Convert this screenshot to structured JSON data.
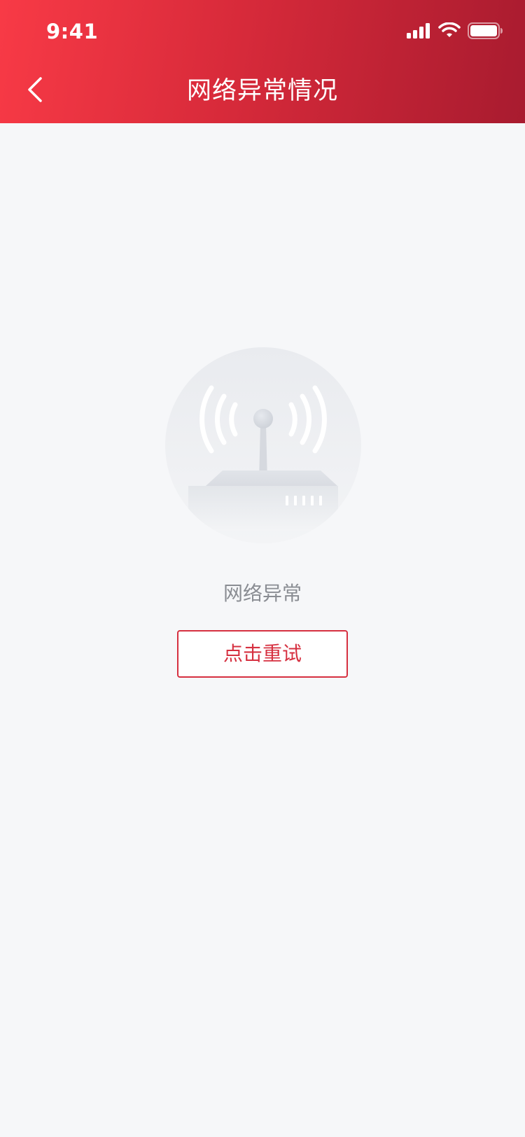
{
  "status_bar": {
    "time": "9:41",
    "icons": [
      "cellular-signal-icon",
      "wifi-icon",
      "battery-icon"
    ]
  },
  "nav": {
    "back_icon": "chevron-left-icon",
    "title": "网络异常情况"
  },
  "illustration": {
    "icon": "router-signal-icon"
  },
  "error": {
    "message": "网络异常",
    "retry_label": "点击重试"
  },
  "colors": {
    "header_gradient_start": "#f83a46",
    "header_gradient_end": "#a81b2f",
    "accent": "#d63040",
    "background": "#f6f7f9",
    "message_text": "#8a8d93"
  }
}
